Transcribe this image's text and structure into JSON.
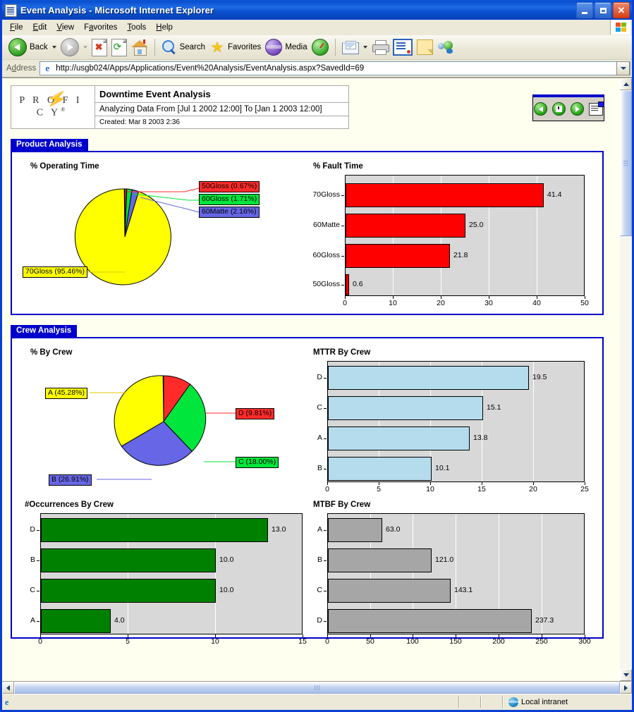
{
  "window": {
    "title": "Event Analysis - Microsoft Internet Explorer",
    "icon": "ie-document-icon",
    "minimize_label": "Minimize",
    "maximize_label": "Maximize",
    "close_label": "Close"
  },
  "menubar": {
    "items": [
      {
        "label": "File",
        "accel": "F",
        "rest": "ile"
      },
      {
        "label": "Edit",
        "accel": "E",
        "rest": "dit"
      },
      {
        "label": "View",
        "accel": "V",
        "rest": "iew"
      },
      {
        "label": "Favorites",
        "pre": "F",
        "accel": "a",
        "rest": "vorites"
      },
      {
        "label": "Tools",
        "accel": "T",
        "rest": "ools"
      },
      {
        "label": "Help",
        "accel": "H",
        "rest": "elp"
      }
    ]
  },
  "toolbar": {
    "back_label": "Back",
    "forward_label": "Forward",
    "stop_label": "Stop",
    "refresh_label": "Refresh",
    "home_label": "Home",
    "search_label": "Search",
    "favorites_label": "Favorites",
    "media_label": "Media",
    "history_label": "History",
    "mail_label": "Mail",
    "print_label": "Print",
    "edit_label": "Edit",
    "discuss_label": "Discuss",
    "messenger_label": "Messenger"
  },
  "address": {
    "label": "Address",
    "url": "http://usgb024/Apps/Applications/Event%20Analysis/EventAnalysis.aspx?SavedId=69",
    "go_caret": "dropdown"
  },
  "report": {
    "logo": "P R O F I C Y",
    "logo_mark": "®",
    "title": "Downtime Event Analysis",
    "subtitle": "Analyzing Data From [Jul 1 2002 12:00] To [Jan 1 2003 12:00]",
    "created": "Created: Mar 8 2003 2:36",
    "nav": {
      "prev_label": "Previous",
      "save_label": "Save",
      "next_label": "Next",
      "report_label": "Report Properties"
    },
    "sections": [
      {
        "id": "product",
        "tab": "Product Analysis"
      },
      {
        "id": "crew",
        "tab": "Crew Analysis"
      }
    ]
  },
  "chart_data": [
    {
      "id": "operating-time",
      "type": "pie",
      "title": "% Operating Time",
      "unit": "%",
      "start_angle": 0,
      "categories": [
        "50Gloss",
        "60Gloss",
        "60Matte",
        "70Gloss"
      ],
      "values": [
        0.67,
        1.71,
        2.16,
        95.46
      ],
      "labels": [
        "50Gloss (0.67%)",
        "60Gloss (1.71%)",
        "60Matte (2.16%)",
        "70Gloss (95.46%)"
      ],
      "colors": [
        "#ff2b2b",
        "#00e63c",
        "#6666e6",
        "#ffff00"
      ],
      "legend": "callout-labels"
    },
    {
      "id": "fault-time",
      "type": "bar",
      "orientation": "horizontal",
      "title": "% Fault Time",
      "categories": [
        "70Gloss",
        "60Matte",
        "60Gloss",
        "50Gloss"
      ],
      "values": [
        41.4,
        25.0,
        21.8,
        0.6
      ],
      "value_labels": [
        "41.4",
        "25.0",
        "21.8",
        "0.6"
      ],
      "xlim": [
        0,
        50
      ],
      "xticks": [
        0,
        10,
        20,
        30,
        40,
        50
      ],
      "xtick_labels": [
        "0",
        "10",
        "20",
        "30",
        "40",
        "50"
      ],
      "bar_color": "#ff0000",
      "plot_bg": "#d8d8d8",
      "grid": true
    },
    {
      "id": "by-crew",
      "type": "pie",
      "title": "% By Crew",
      "unit": "%",
      "start_angle": 0,
      "categories": [
        "D",
        "C",
        "B",
        "A"
      ],
      "values": [
        9.81,
        18.0,
        26.91,
        45.28
      ],
      "labels": [
        "D (9.81%)",
        "C (18.00%)",
        "B (26.91%)",
        "A (45.28%)"
      ],
      "colors": [
        "#ff2b2b",
        "#00e63c",
        "#6666e6",
        "#ffff00"
      ],
      "legend": "callout-labels"
    },
    {
      "id": "mttr-by-crew",
      "type": "bar",
      "orientation": "horizontal",
      "title": "MTTR By Crew",
      "categories": [
        "D",
        "C",
        "A",
        "B"
      ],
      "values": [
        19.5,
        15.1,
        13.8,
        10.1
      ],
      "value_labels": [
        "19.5",
        "15.1",
        "13.8",
        "10.1"
      ],
      "xlim": [
        0,
        25
      ],
      "xticks": [
        0,
        5,
        10,
        15,
        20,
        25
      ],
      "xtick_labels": [
        "0",
        "5",
        "10",
        "15",
        "20",
        "25"
      ],
      "bar_color": "#b5dced",
      "plot_bg": "#d8d8d8",
      "grid": true
    },
    {
      "id": "occurrences-by-crew",
      "type": "bar",
      "orientation": "horizontal",
      "title": "#Occurrences By Crew",
      "categories": [
        "D",
        "B",
        "C",
        "A"
      ],
      "values": [
        13.0,
        10.0,
        10.0,
        4.0
      ],
      "value_labels": [
        "13.0",
        "10.0",
        "10.0",
        "4.0"
      ],
      "xlim": [
        0,
        15
      ],
      "xticks": [
        0,
        5,
        10,
        15
      ],
      "xtick_labels": [
        "0",
        "5",
        "10",
        "15"
      ],
      "bar_color": "#008000",
      "plot_bg": "#d8d8d8",
      "grid": true
    },
    {
      "id": "mtbf-by-crew",
      "type": "bar",
      "orientation": "horizontal",
      "title": "MTBF By Crew",
      "categories": [
        "A",
        "B",
        "C",
        "D"
      ],
      "values": [
        63.0,
        121.0,
        143.1,
        237.3
      ],
      "value_labels": [
        "63.0",
        "121.0",
        "143.1",
        "237.3"
      ],
      "xlim": [
        0,
        300
      ],
      "xticks": [
        0,
        50,
        100,
        150,
        200,
        250,
        300
      ],
      "xtick_labels": [
        "0",
        "50",
        "100",
        "150",
        "200",
        "250",
        "300"
      ],
      "bar_color": "#a6a6a6",
      "plot_bg": "#d8d8d8",
      "grid": true
    }
  ],
  "statusbar": {
    "message": "",
    "zone": "Local intranet",
    "zone_icon": "globe-icon"
  }
}
